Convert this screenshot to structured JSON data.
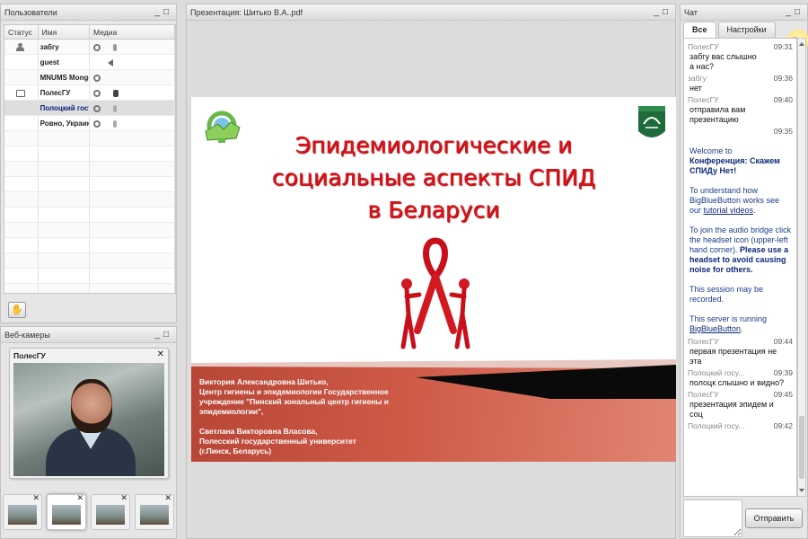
{
  "users": {
    "title": "Пользователи",
    "headers": [
      "Статус",
      "Имя",
      "Медиа"
    ],
    "rows": [
      {
        "name": "забгу",
        "status": "person",
        "media": "cam-mic"
      },
      {
        "name": "guest",
        "status": "",
        "media": "speaker"
      },
      {
        "name": "MNUMS Mongolia",
        "status": "",
        "media": "cam"
      },
      {
        "name": "ПолесГУ",
        "status": "presenter",
        "media": "cam-mic-active"
      },
      {
        "name": "Полоцкий госу",
        "status": "",
        "media": "cam-mic-mute",
        "selected": true
      },
      {
        "name": "Ровно, Украина",
        "status": "",
        "media": "cam-mic-mute"
      }
    ],
    "raise_hand_icon": "raise-hand-icon"
  },
  "webcams": {
    "title": "Веб-камеры",
    "main_label": "ПолесГУ",
    "close": "✕"
  },
  "presentation": {
    "title": "Презентация: Шитько В.А..pdf",
    "slide_title_lines": [
      "Эпидемиологические и",
      "социальные аспекты СПИД",
      "в Беларуси"
    ],
    "credits": [
      "Виктория Александровна Шитько,\nЦентр гигиены и эпидемиологии Государственное\nучреждение  \"Пинский  зональный центр гигиены и\nэпидемиологии\",",
      "Светлана Викторовна Власова,\nПолесский государственный университет\n(г.Пинск, Беларусь)"
    ]
  },
  "chat": {
    "title": "Чат",
    "tabs": [
      "Все",
      "Настройки"
    ],
    "notify": "Чат",
    "send_label": "Отправить",
    "messages_top": [
      {
        "sender": "ПолесГУ",
        "time": "09:31",
        "lines": [
          "забгу вас слышно",
          "а нас?"
        ]
      },
      {
        "sender": "забгу",
        "time": "09:36",
        "lines": [
          "нет"
        ]
      },
      {
        "sender": "ПолесГУ",
        "time": "09:40",
        "lines": [
          "отправила вам",
          "презентацию"
        ],
        "extra_time": "09:35"
      }
    ],
    "welcome": {
      "p1a": "Welcome to",
      "p1b": "Конференция: Скажем СПИДу Нет!",
      "p2a": "To understand how BigBlueButton works see our",
      "p2link": "tutorial videos",
      "p2end": ".",
      "p3a": "To join the audio bridge click the headset icon (upper-left hand corner).",
      "p3b": "Please use a headset to avoid causing noise for others.",
      "p4": "This session may be recorded.",
      "p5a": "This server is running",
      "p5link": "BigBlueButton",
      "p5end": "."
    },
    "messages_bottom": [
      {
        "sender": "ПолесГУ",
        "time": "09:44",
        "lines": [
          "первая презентация не",
          "эта"
        ]
      },
      {
        "sender": "Полоцкий госу...",
        "time": "09:39",
        "lines": [
          "полоцк слышно и видно?"
        ]
      },
      {
        "sender": "ПолесГУ",
        "time": "09:45",
        "lines": [
          "презентация эпидем и",
          "соц"
        ]
      },
      {
        "sender": "Полоцкий госу...",
        "time": "09:42",
        "lines": []
      }
    ]
  },
  "colors": {
    "slide_title": "#d8141c",
    "banner": "#cf5a48",
    "link": "#1a3d8a"
  }
}
